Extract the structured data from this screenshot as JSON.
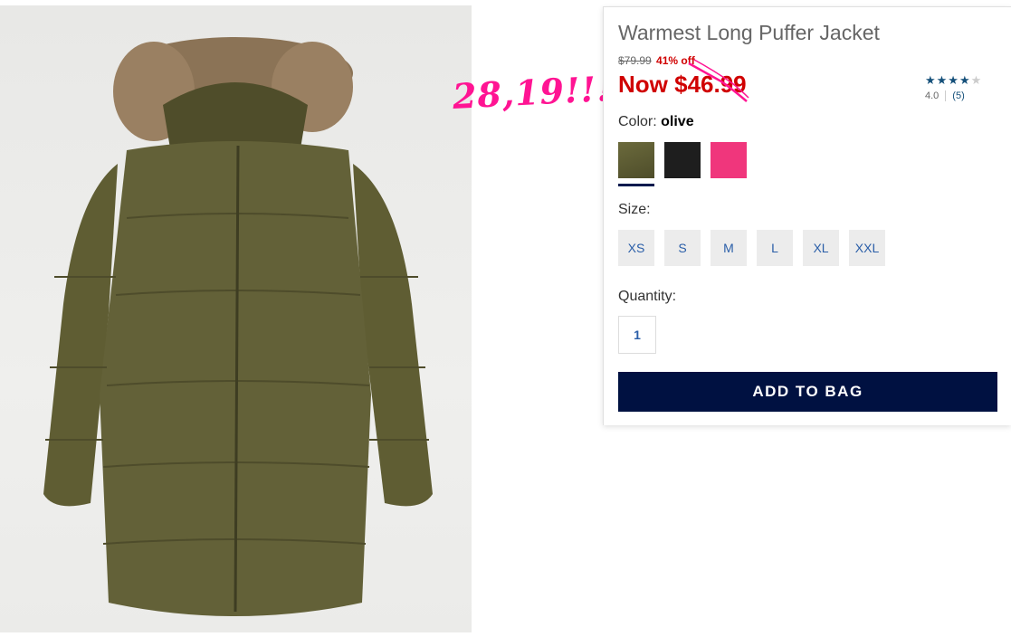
{
  "product": {
    "title": "Warmest Long Puffer Jacket",
    "original_price": "$79.99",
    "discount": "41% off",
    "now_price": "Now $46.99",
    "rating_value": "4.0",
    "rating_count": "(5)",
    "stars_filled": 4,
    "stars_total": 5
  },
  "annotation": {
    "handwritten_price": "28,19!!!"
  },
  "color": {
    "label": "Color:",
    "selected": "olive",
    "swatches": [
      {
        "name": "olive",
        "hex": "#5a5a32"
      },
      {
        "name": "black",
        "hex": "#1e1e1e"
      },
      {
        "name": "pink",
        "hex": "#f0367c"
      }
    ]
  },
  "size": {
    "label": "Size:",
    "options": [
      "XS",
      "S",
      "M",
      "L",
      "XL",
      "XXL"
    ]
  },
  "quantity": {
    "label": "Quantity:",
    "value": "1"
  },
  "cta": {
    "add_to_bag": "ADD TO BAG"
  },
  "colors": {
    "sale_red": "#d00000",
    "navy": "#001141",
    "link_blue": "#2a5ea8",
    "annotation_pink": "#ff1493"
  }
}
